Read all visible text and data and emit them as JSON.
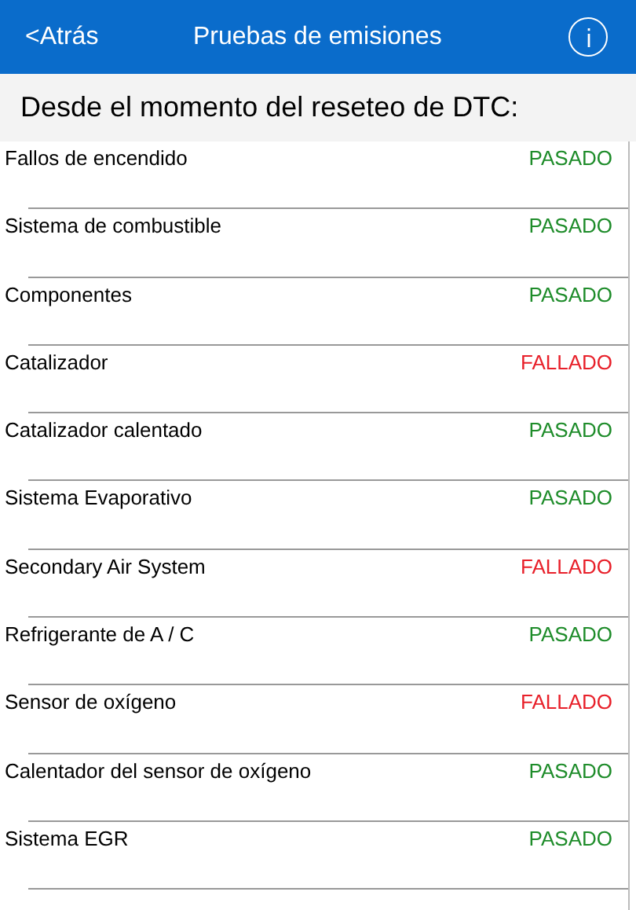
{
  "nav_bar": {
    "back": "<Atrás",
    "title": "Pruebas de emisiones"
  },
  "section_header": "Desde el momento del reseteo de DTC:",
  "tests": [
    {
      "name": "Fallos de encendido",
      "result": "PASADO",
      "kind": "passed"
    },
    {
      "name": "Sistema de combustible",
      "result": "PASADO",
      "kind": "passed"
    },
    {
      "name": "Componentes",
      "result": "PASADO",
      "kind": "passed"
    },
    {
      "name": "Catalizador",
      "result": "FALLADO",
      "kind": "failed"
    },
    {
      "name": "Catalizador calentado",
      "result": "PASADO",
      "kind": "passed"
    },
    {
      "name": "Sistema Evaporativo",
      "result": "PASADO",
      "kind": "passed"
    },
    {
      "name": "Secondary Air System",
      "result": "FALLADO",
      "kind": "failed"
    },
    {
      "name": "Refrigerante de A / C",
      "result": "PASADO",
      "kind": "passed"
    },
    {
      "name": "Sensor de oxígeno",
      "result": "FALLADO",
      "kind": "failed"
    },
    {
      "name": "Calentador del sensor de oxígeno",
      "result": "PASADO",
      "kind": "passed"
    },
    {
      "name": "Sistema EGR",
      "result": "PASADO",
      "kind": "passed"
    }
  ]
}
